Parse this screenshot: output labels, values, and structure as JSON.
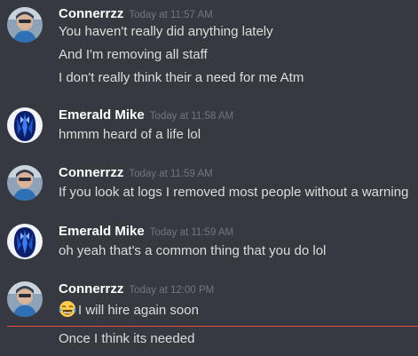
{
  "messages": [
    {
      "username": "Connerrzz",
      "timestamp": "Today at 11:57 AM",
      "lines": [
        "You haven't really did anything lately",
        "And I'm removing all staff",
        "I don't really think their a need for me Atm"
      ]
    },
    {
      "username": "Emerald Mike",
      "timestamp": "Today at 11:58 AM",
      "lines": [
        "hmmm heard of a life lol"
      ]
    },
    {
      "username": "Connerrzz",
      "timestamp": "Today at 11:59 AM",
      "lines": [
        "If you look at logs I removed most people without a warning"
      ]
    },
    {
      "username": "Emerald Mike",
      "timestamp": "Today at 11:59 AM",
      "lines": [
        "oh yeah that's a common thing that you do lol"
      ]
    },
    {
      "username": "Connerrzz",
      "timestamp": "Today at 12:00 PM",
      "lines": [
        "I will hire again soon",
        "Once I think its needed"
      ]
    }
  ],
  "emoji_icon": "face-with-tears-of-joy-icon",
  "colors": {
    "background": "#36393f",
    "username": "#ffffff",
    "timestamp": "#72767d",
    "message": "#dcddde",
    "new_messages_divider": "#f04747"
  }
}
